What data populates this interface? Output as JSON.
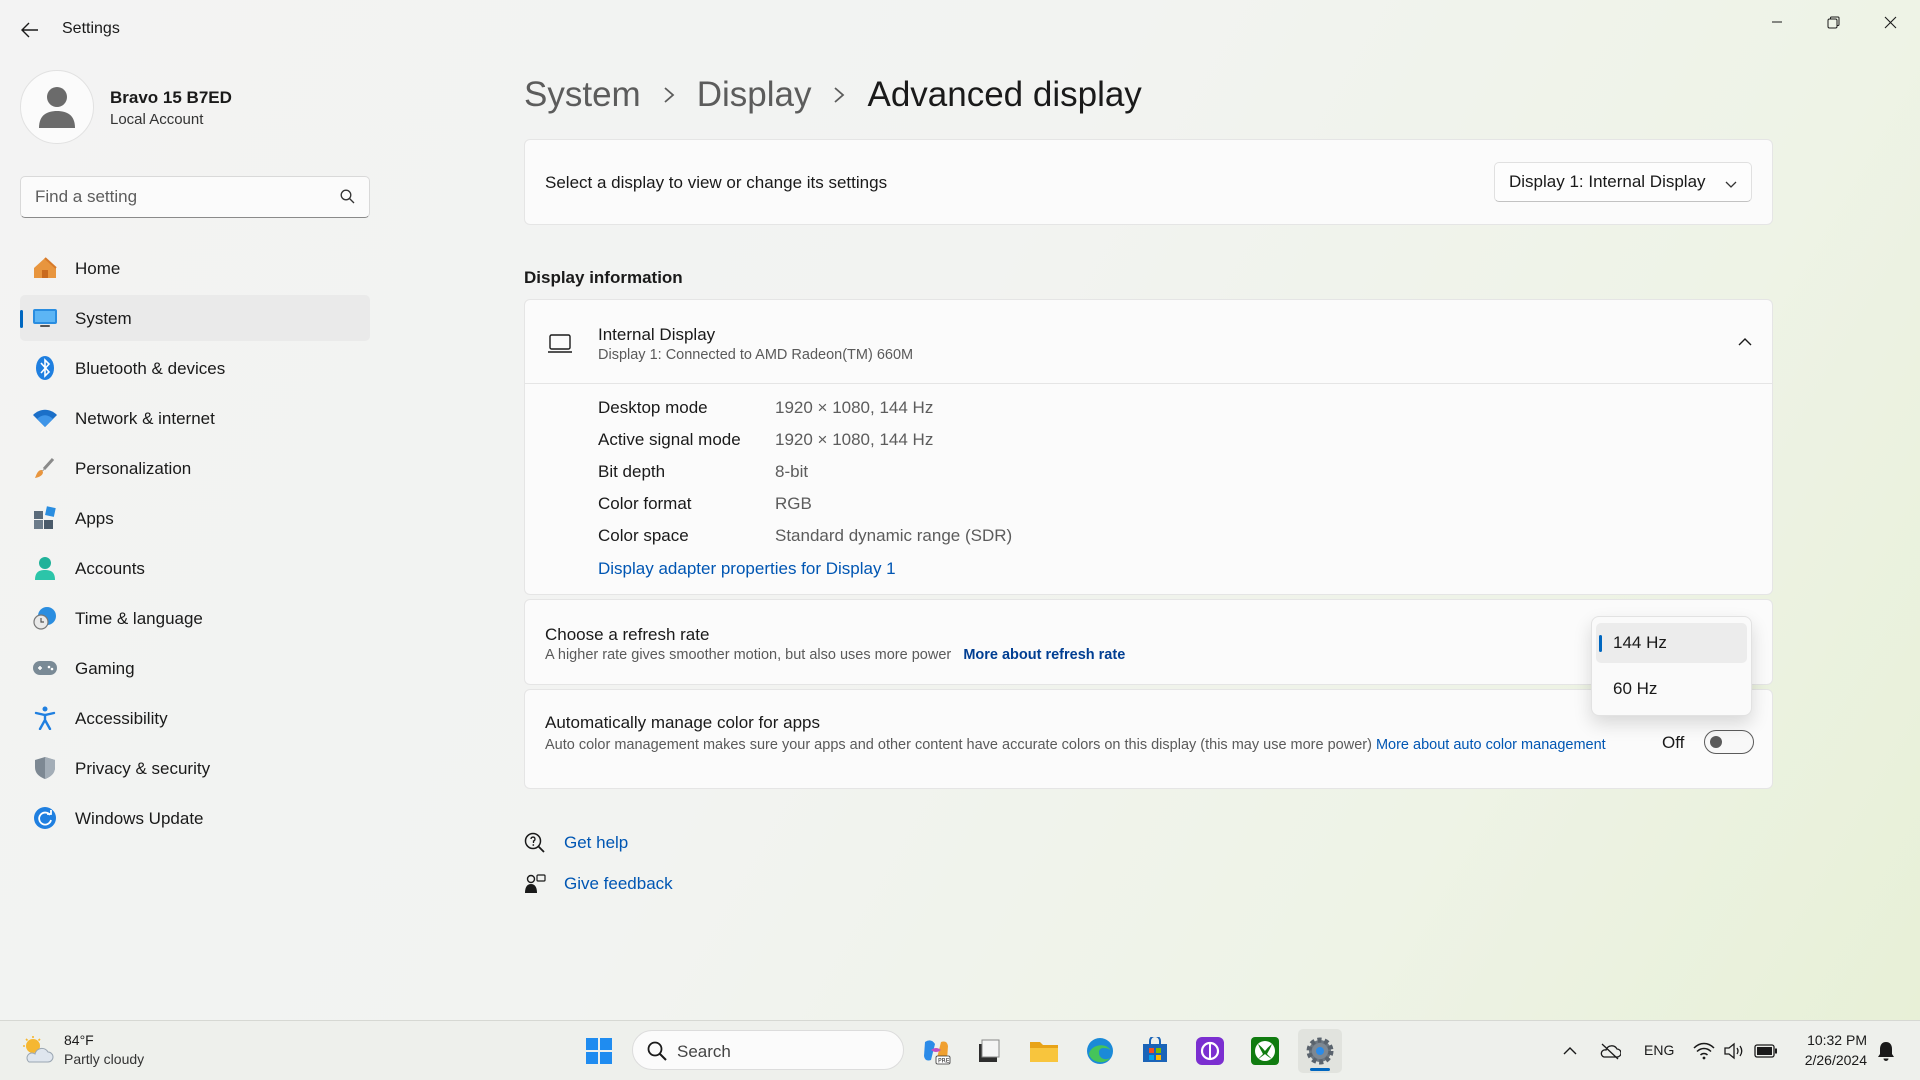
{
  "window": {
    "title": "Settings",
    "controls": {
      "minimize": "minimize",
      "restore": "restore",
      "close": "close"
    }
  },
  "profile": {
    "name": "Bravo 15 B7ED",
    "account_type": "Local Account"
  },
  "search": {
    "placeholder": "Find a setting",
    "value": ""
  },
  "sidebar": {
    "items": [
      {
        "label": "Home",
        "icon": "home-icon",
        "active": false
      },
      {
        "label": "System",
        "icon": "monitor-icon",
        "active": true
      },
      {
        "label": "Bluetooth & devices",
        "icon": "bluetooth-icon",
        "active": false
      },
      {
        "label": "Network & internet",
        "icon": "wifi-icon",
        "active": false
      },
      {
        "label": "Personalization",
        "icon": "brush-icon",
        "active": false
      },
      {
        "label": "Apps",
        "icon": "apps-icon",
        "active": false
      },
      {
        "label": "Accounts",
        "icon": "person-icon",
        "active": false
      },
      {
        "label": "Time & language",
        "icon": "clock-globe-icon",
        "active": false
      },
      {
        "label": "Gaming",
        "icon": "gamepad-icon",
        "active": false
      },
      {
        "label": "Accessibility",
        "icon": "accessibility-icon",
        "active": false
      },
      {
        "label": "Privacy & security",
        "icon": "shield-icon",
        "active": false
      },
      {
        "label": "Windows Update",
        "icon": "refresh-icon",
        "active": false
      }
    ]
  },
  "breadcrumb": {
    "items": [
      "System",
      "Display"
    ],
    "current": "Advanced display"
  },
  "display_select": {
    "label": "Select a display to view or change its settings",
    "selected": "Display 1: Internal Display"
  },
  "display_info": {
    "section_title": "Display information",
    "name": "Internal Display",
    "connection": "Display 1: Connected to AMD Radeon(TM) 660M",
    "rows": [
      {
        "key": "Desktop mode",
        "value": "1920 × 1080, 144 Hz"
      },
      {
        "key": "Active signal mode",
        "value": "1920 × 1080, 144 Hz"
      },
      {
        "key": "Bit depth",
        "value": "8-bit"
      },
      {
        "key": "Color format",
        "value": "RGB"
      },
      {
        "key": "Color space",
        "value": "Standard dynamic range (SDR)"
      }
    ],
    "adapter_link": "Display adapter properties for Display 1"
  },
  "refresh_rate": {
    "title": "Choose a refresh rate",
    "description": "A higher rate gives smoother motion, but also uses more power",
    "link": "More about refresh rate",
    "options": [
      "144 Hz",
      "60 Hz"
    ],
    "selected": "144 Hz"
  },
  "auto_color": {
    "title": "Automatically manage color for apps",
    "description": "Auto color management makes sure your apps and other content have accurate colors on this display (this may use more power)",
    "link_part1": "More about auto color",
    "link_part2": "management",
    "state_label": "Off",
    "enabled": false
  },
  "help": {
    "get_help": "Get help",
    "give_feedback": "Give feedback"
  },
  "taskbar": {
    "weather": {
      "temp": "84°F",
      "condition": "Partly cloudy"
    },
    "search_label": "Search",
    "apps": [
      "start-icon",
      "copilot-icon",
      "file-icon",
      "folder-icon",
      "edge-icon",
      "store-icon",
      "app-icon",
      "xbox-icon",
      "settings-icon"
    ],
    "tray": {
      "language": "ENG",
      "time": "10:32 PM",
      "date": "2/26/2024"
    }
  },
  "colors": {
    "accent": "#0067c0",
    "link": "#0056b3",
    "link_bold": "#003e92"
  }
}
